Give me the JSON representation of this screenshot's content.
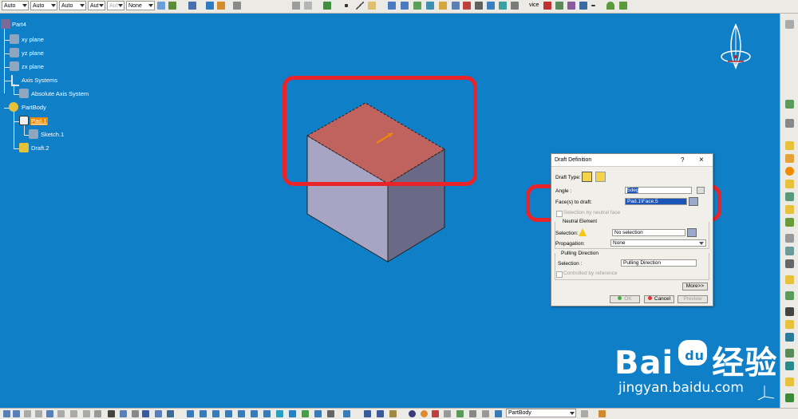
{
  "toolbar": {
    "combos": [
      "Auto",
      "Auto",
      "Auto",
      "Aut",
      "Aut",
      "None"
    ],
    "view_label": "vice"
  },
  "tree": {
    "root": "Part4",
    "planes": [
      "xy plane",
      "yz plane",
      "zx plane"
    ],
    "axis_systems": "Axis Systems",
    "absolute_axis": "Absolute Axis System",
    "part_body": "PartBody",
    "pad": "Pad.1",
    "sketch": "Sketch.1",
    "draft": "Draft.2"
  },
  "dialog": {
    "title": "Draft Definition",
    "help": "?",
    "close": "×",
    "draft_type_label": "Draft Type:",
    "angle_label": "Angle :",
    "angle_value": "5deg",
    "faces_label": "Face(s) to draft:",
    "faces_value": "Pad.1\\Face.5",
    "selection_by_neutral": "Selection by neutral face",
    "neutral_element": "Neutral Element",
    "selection_label": "Selection:",
    "selection_value": "No selection",
    "propagation_label": "Propagation:",
    "propagation_value": "None",
    "pulling_title": "Pulling Direction",
    "pulling_selection_label": "Selection :",
    "pulling_selection_value": "Pulling Direction",
    "controlled_by_reference": "Controlled by reference",
    "more_button": "More>>",
    "ok_button": "OK",
    "cancel_button": "Cancel",
    "preview_button": "Preview"
  },
  "bottom": {
    "body_combo": "PartBody"
  },
  "watermark": {
    "brand": "Bai",
    "brand2": "经验",
    "du": "du",
    "url": "jingyan.baidu.com"
  },
  "colors": {
    "canvas": "#0f7fc8",
    "highlight": "#e8232a",
    "selected_face": "#c0625e",
    "box_face": "#a7a4c4"
  }
}
